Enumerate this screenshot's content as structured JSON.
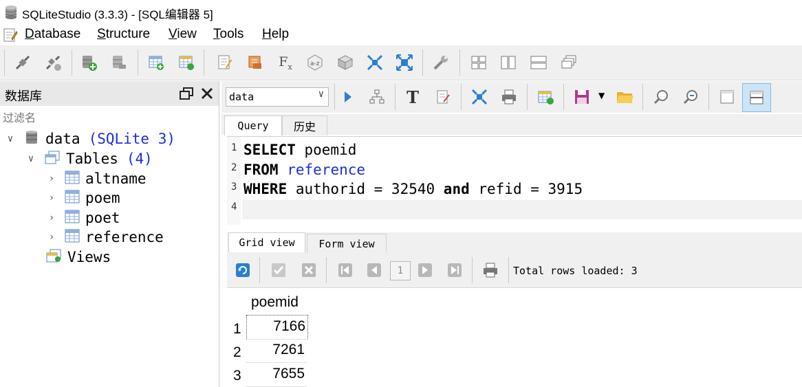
{
  "window": {
    "title": "SQLiteStudio (3.3.3) - [SQL编辑器 5]"
  },
  "menu": {
    "items": [
      {
        "label": "Database",
        "underline": "D"
      },
      {
        "label": "Structure",
        "underline": "S"
      },
      {
        "label": "View",
        "underline": "V"
      },
      {
        "label": "Tools",
        "underline": "T"
      },
      {
        "label": "Help",
        "underline": "H"
      }
    ]
  },
  "dock": {
    "title": "数据库",
    "filter_placeholder": "过滤名",
    "tree": {
      "db_name": "data",
      "db_type": "(SQLite 3)",
      "tables_label": "Tables",
      "tables_count": "(4)",
      "tables": [
        "altname",
        "poem",
        "poet",
        "reference"
      ],
      "views_label": "Views"
    }
  },
  "editor_toolbar": {
    "database_selected": "data"
  },
  "editor_tabs": {
    "query": "Query",
    "history": "历史"
  },
  "editor": {
    "line_numbers": [
      "1",
      "2",
      "3",
      "4"
    ],
    "line1": {
      "kw": "SELECT",
      "rest": " poemid"
    },
    "line2": {
      "kw": "FROM",
      "table": "reference"
    },
    "line3": {
      "kw1": "WHERE",
      "mid": " authorid = 32540 ",
      "kw2": "and",
      "rest": " refid = 3915"
    }
  },
  "results_tabs": {
    "grid": "Grid view",
    "form": "Form view"
  },
  "results_toolbar": {
    "page": "1",
    "status": "Total rows loaded: 3"
  },
  "grid": {
    "columns": [
      "poemid"
    ],
    "rows": [
      {
        "num": "1",
        "poemid": "7166"
      },
      {
        "num": "2",
        "poemid": "7261"
      },
      {
        "num": "3",
        "poemid": "7655"
      }
    ]
  },
  "colors": {
    "keyword_blue": "#1a2fd6",
    "selected_button": "#cde4f7"
  }
}
